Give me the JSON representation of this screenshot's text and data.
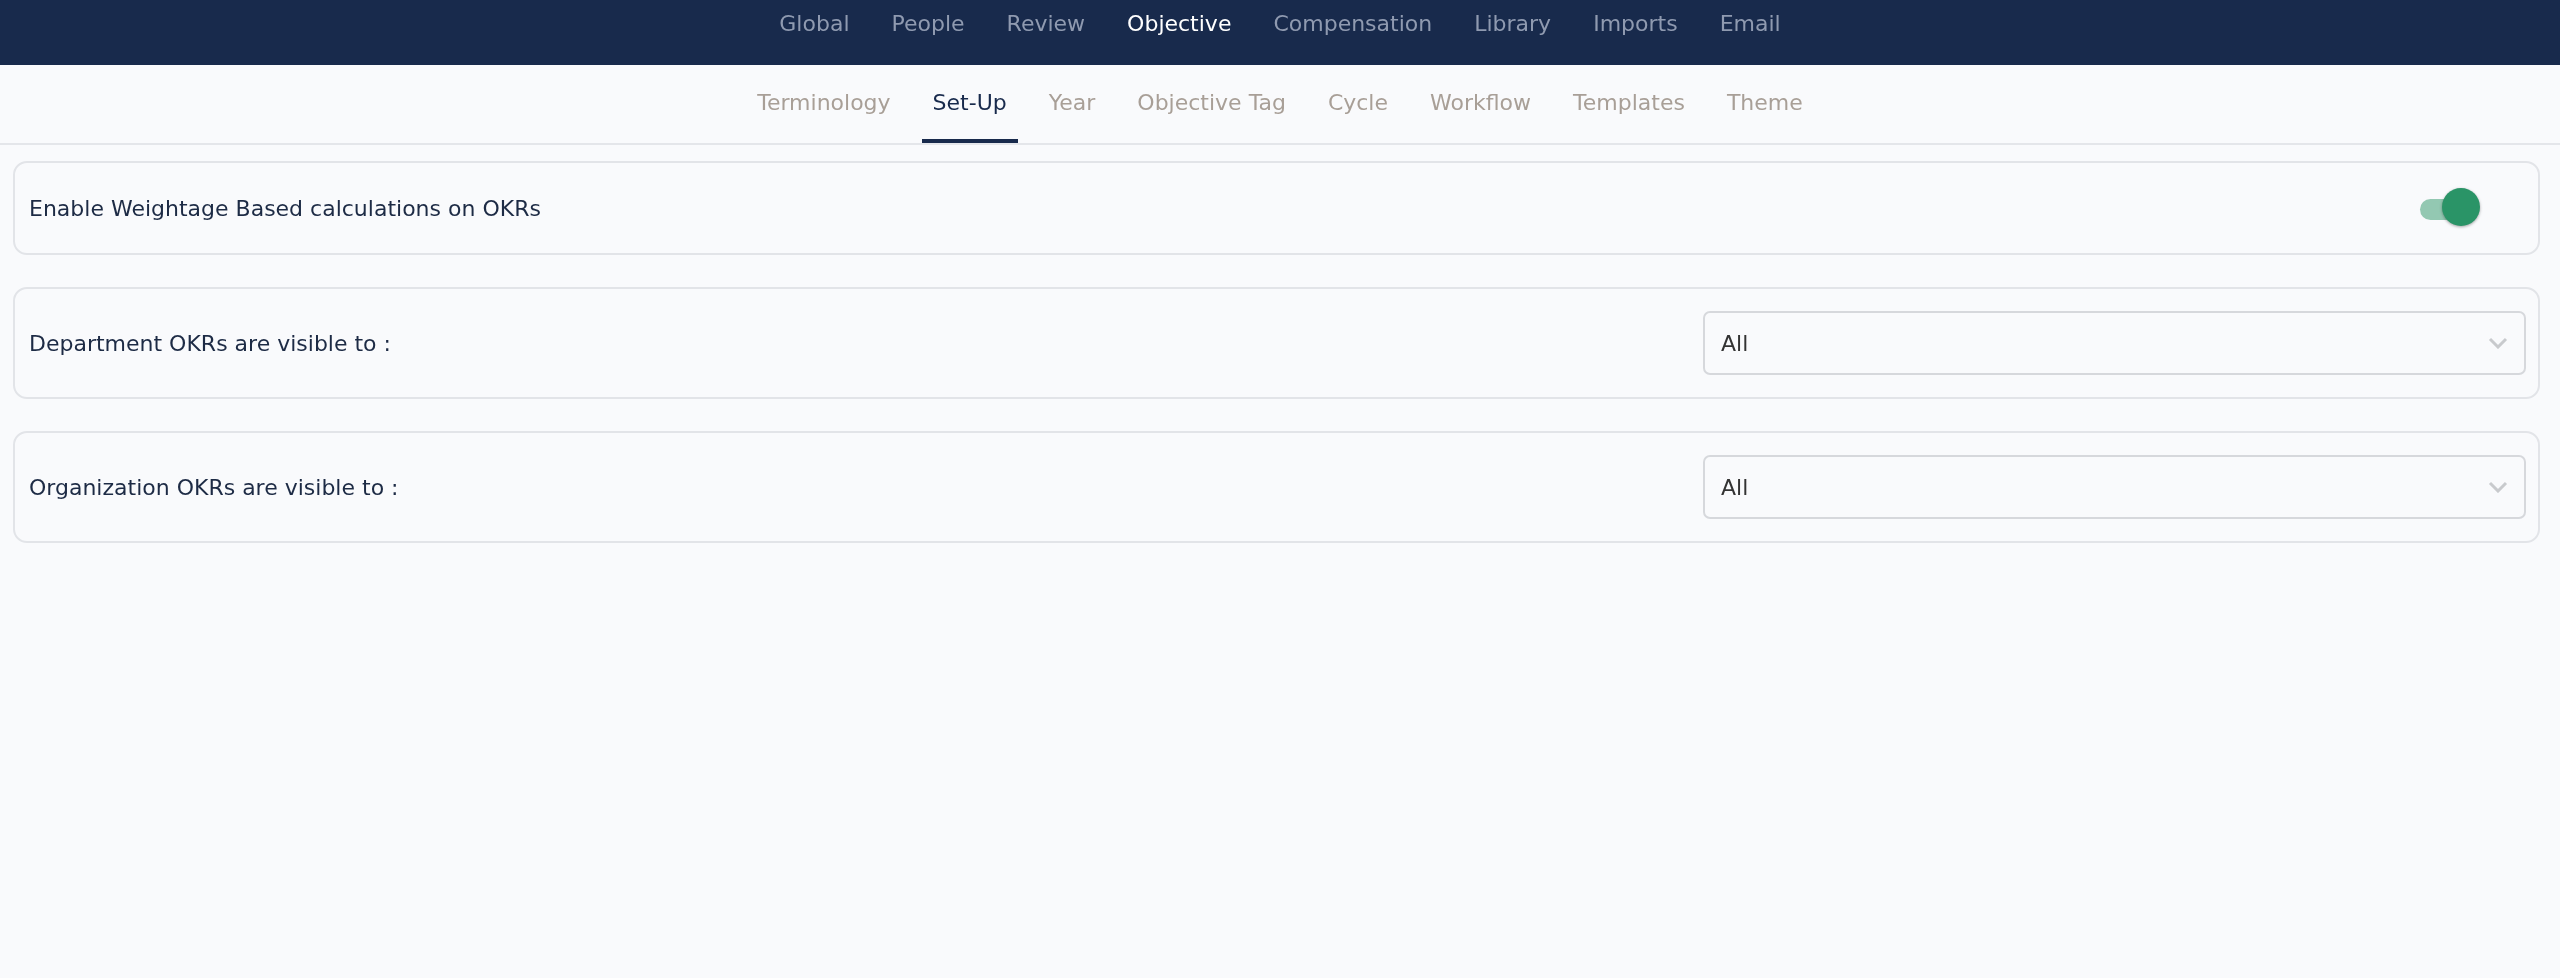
{
  "main_nav": [
    {
      "label": "Global",
      "selected": false
    },
    {
      "label": "People",
      "selected": false
    },
    {
      "label": "Review",
      "selected": false
    },
    {
      "label": "Objective",
      "selected": true
    },
    {
      "label": "Compensation",
      "selected": false
    },
    {
      "label": "Library",
      "selected": false
    },
    {
      "label": "Imports",
      "selected": false
    },
    {
      "label": "Email",
      "selected": false
    }
  ],
  "sub_nav": [
    {
      "label": "Terminology",
      "selected": false
    },
    {
      "label": "Set-Up",
      "selected": true
    },
    {
      "label": "Year",
      "selected": false
    },
    {
      "label": "Objective Tag",
      "selected": false
    },
    {
      "label": "Cycle",
      "selected": false
    },
    {
      "label": "Workflow",
      "selected": false
    },
    {
      "label": "Templates",
      "selected": false
    },
    {
      "label": "Theme",
      "selected": false
    }
  ],
  "settings": [
    {
      "kind": "toggle",
      "label": "Enable Weightage Based calculations on OKRs",
      "on": true
    },
    {
      "kind": "select",
      "label": "Department OKRs are visible to :",
      "value": "All"
    },
    {
      "kind": "select",
      "label": "Organization OKRs are visible to :",
      "value": "All"
    }
  ]
}
